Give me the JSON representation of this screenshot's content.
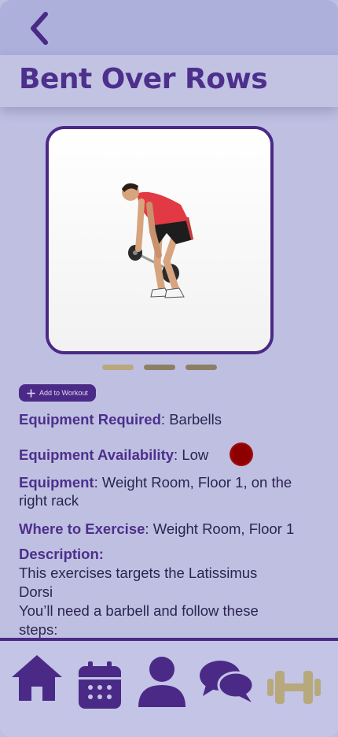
{
  "header": {
    "title": "Bent Over Rows"
  },
  "carousel": {
    "page_count": 3,
    "active_index": 0
  },
  "actions": {
    "add_label": "Add to Workout"
  },
  "details": {
    "equipment_required": {
      "label": "Equipment Required",
      "value": "Barbells"
    },
    "equipment_availability": {
      "label": "Equipment Availability",
      "value": "Low",
      "indicator_color": "#8e0000"
    },
    "equipment": {
      "label": "Equipment",
      "value": "Weight Room, Floor 1, on the right rack"
    },
    "where": {
      "label": "Where to Exercise",
      "value": "Weight Room, Floor 1"
    },
    "description": {
      "label": "Description",
      "lines": [
        "This exercises targets the Latissimus",
        "Dorsi",
        "You’ll need a barbell and follow these",
        "steps:"
      ]
    }
  },
  "nav": {
    "items": [
      "home-icon",
      "calendar-icon",
      "profile-icon",
      "chat-icon",
      "dumbbell-icon"
    ],
    "active": "dumbbell-icon"
  },
  "colors": {
    "accent": "#4a2a86",
    "title": "#4d2f8c",
    "active_nav": "#b8a97c",
    "background": "#bfc0e1"
  }
}
